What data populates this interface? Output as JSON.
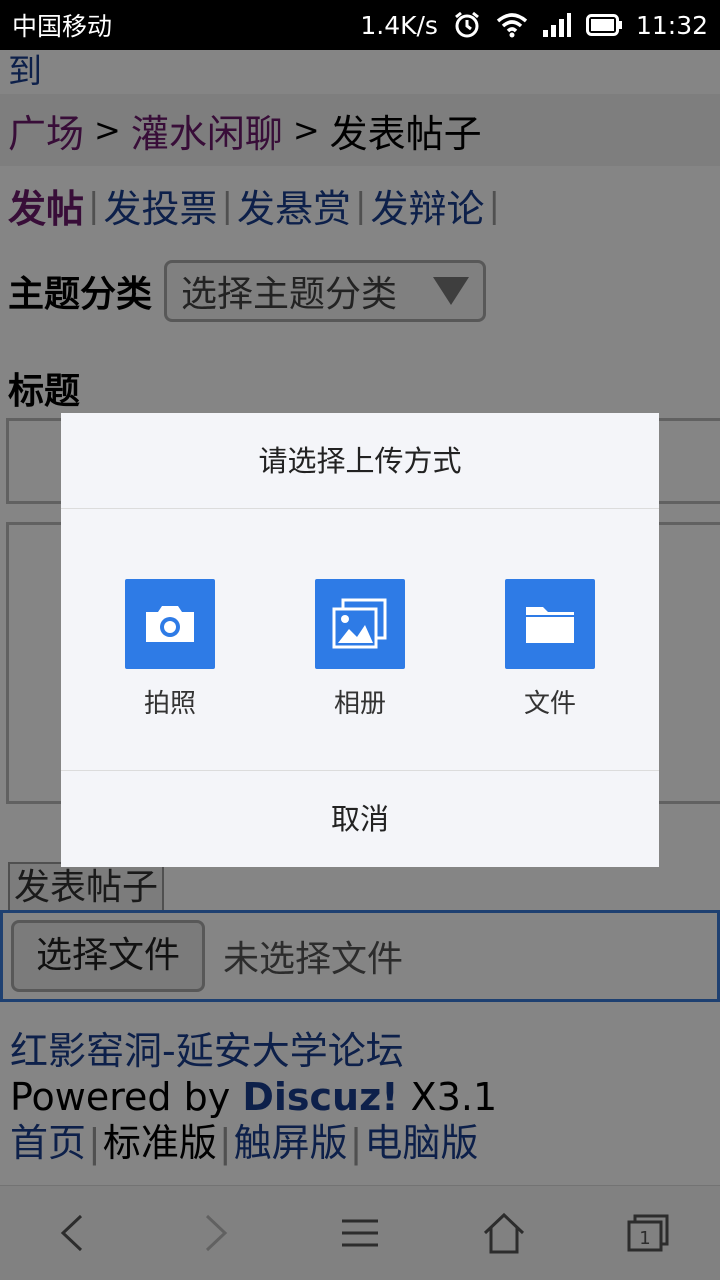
{
  "status_bar": {
    "carrier": "中国移动",
    "speed": "1.4K/s",
    "time": "11:32"
  },
  "page": {
    "top_clip_text": "到",
    "breadcrumb": {
      "plaza": "广场",
      "separator": ">",
      "forum": "灌水闲聊",
      "current": "发表帖子"
    },
    "tabs": [
      {
        "label": "发帖"
      },
      {
        "label": "发投票"
      },
      {
        "label": "发悬赏"
      },
      {
        "label": "发辩论"
      }
    ],
    "tab_separator": "|",
    "topic": {
      "label": "主题分类",
      "selected": "选择主题分类"
    },
    "title_label": "标题",
    "submit_label": "发表帖子",
    "file": {
      "button_label": "选择文件",
      "status": "未选择文件"
    },
    "footer": {
      "site_name": "红影窑洞-延安大学论坛",
      "powered_prefix": "Powered by",
      "brand": "Discuz!",
      "version": "X3.1",
      "links": [
        {
          "label": "首页"
        },
        {
          "label": "标准版"
        },
        {
          "label": "触屏版"
        },
        {
          "label": "电脑版"
        }
      ]
    }
  },
  "dialog": {
    "title": "请选择上传方式",
    "options": [
      {
        "label": "拍照",
        "icon": "camera-icon"
      },
      {
        "label": "相册",
        "icon": "gallery-icon"
      },
      {
        "label": "文件",
        "icon": "folder-icon"
      }
    ],
    "cancel_label": "取消",
    "accent_color": "#2e7be6"
  },
  "bottom_nav": {
    "icons": [
      "back-icon",
      "forward-icon",
      "menu-icon",
      "home-icon",
      "tabs-icon"
    ],
    "tabs_count": "1"
  }
}
